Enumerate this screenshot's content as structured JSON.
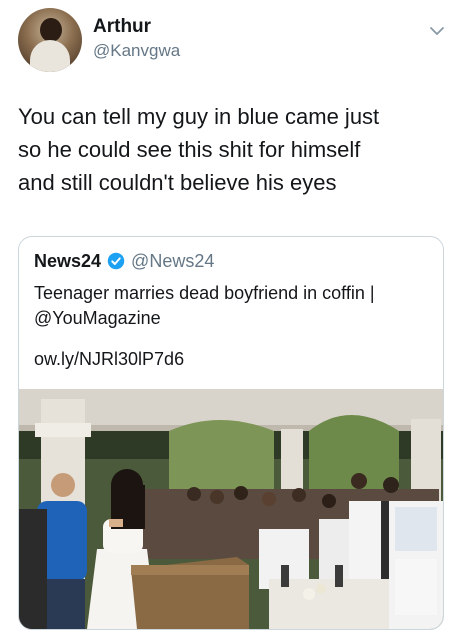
{
  "author": {
    "name": "Arthur",
    "handle": "@Kanvgwa",
    "avatar_icon": "profile-photo"
  },
  "tweet": {
    "lines": [
      "You can tell my guy in blue came just",
      "so he could see this shit for himself",
      "and still couldn't believe his eyes"
    ]
  },
  "quoted": {
    "name": "News24",
    "handle": "@News24",
    "verified_icon": "verified-badge-icon",
    "text_lines": [
      "Teenager marries dead boyfriend in coffin |",
      "@YouMagazine"
    ],
    "link": "ow.ly/NJRl30lP7d6",
    "media": "photo of wedding ceremony beside white coffin"
  },
  "colors": {
    "primary_text": "#14171a",
    "secondary_text": "#657786",
    "verified": "#1da1f2",
    "border": "#ccd6dd"
  }
}
